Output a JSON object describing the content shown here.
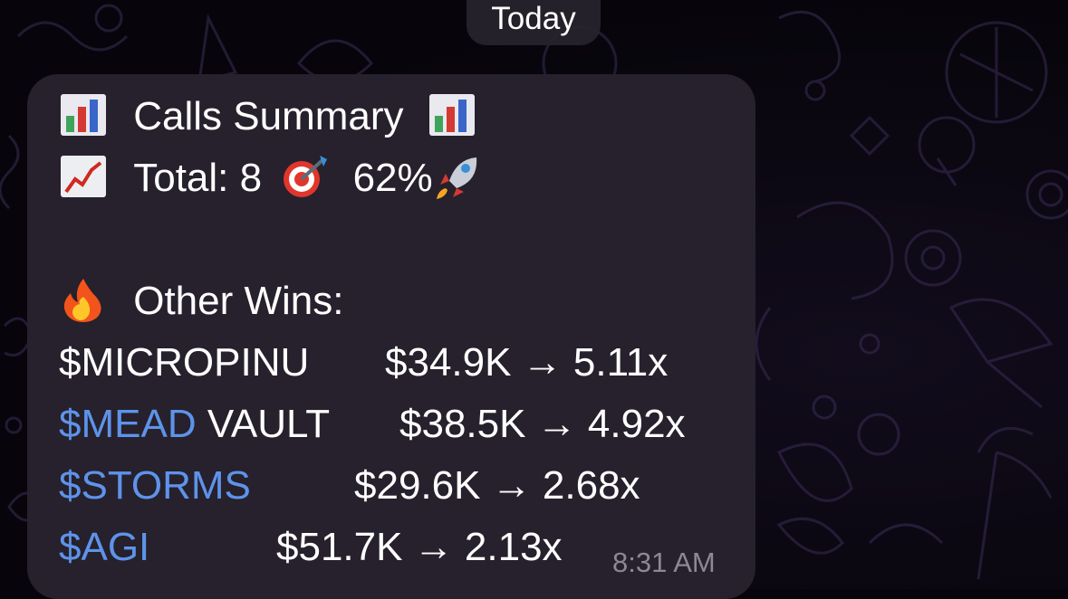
{
  "date_separator": "Today",
  "message": {
    "title_icon": "bar-chart-icon",
    "title": "Calls Summary",
    "total_icon": "chart-increasing-icon",
    "total_label": "Total: 8",
    "rate_icon": "direct-hit-icon",
    "rate": "62%",
    "rate_suffix_icon": "rocket-icon",
    "section_icon": "fire-icon",
    "section_title": "Other Wins:",
    "wins": [
      {
        "ticker": "$MICROPINU",
        "ticker_is_link": false,
        "suffix": "",
        "stat": "$34.9K → 5.11x"
      },
      {
        "ticker": "$MEAD",
        "ticker_is_link": true,
        "suffix": " VAULT",
        "stat": "$38.5K → 4.92x"
      },
      {
        "ticker": "$STORMS",
        "ticker_is_link": true,
        "suffix": "",
        "stat": "$29.6K → 2.68x"
      },
      {
        "ticker": "$AGI",
        "ticker_is_link": true,
        "suffix": "",
        "stat": "$51.7K → 2.13x"
      }
    ],
    "time": "8:31 AM"
  },
  "colors": {
    "background": "#07050b",
    "bubble": "#26212c",
    "text": "#ffffff",
    "link": "#5e93ea",
    "timestamp": "#8d8796"
  }
}
